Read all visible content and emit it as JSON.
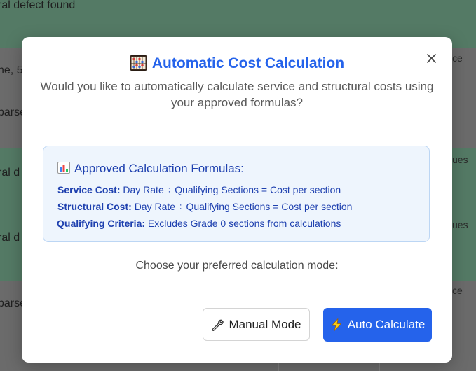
{
  "background": {
    "rows": [
      {
        "text": "ral defect found",
        "right": ""
      },
      {
        "text": "ne, 5",
        "right": "ce"
      },
      {
        "text": "parse",
        "right": ""
      },
      {
        "text": "ral d",
        "right": "ues"
      },
      {
        "text": "ral d",
        "right": "ues"
      },
      {
        "text": "parse",
        "right": "ce"
      }
    ]
  },
  "modal": {
    "title": "Automatic Cost Calculation",
    "title_icon": "abacus-icon",
    "subtitle": "Would you like to automatically calculate service and structural costs using your approved formulas?",
    "close_icon": "close-icon",
    "formulas": {
      "heading": "Approved Calculation Formulas:",
      "heading_icon": "bar-chart-icon",
      "items": [
        {
          "label": "Service Cost:",
          "value": "Day Rate ÷ Qualifying Sections = Cost per section"
        },
        {
          "label": "Structural Cost:",
          "value": "Day Rate ÷ Qualifying Sections = Cost per section"
        },
        {
          "label": "Qualifying Criteria:",
          "value": "Excludes Grade 0 sections from calculations"
        }
      ]
    },
    "prompt": "Choose your preferred calculation mode:",
    "manual_button": {
      "label": "Manual Mode",
      "icon": "wrench-icon"
    },
    "auto_button": {
      "label": "Auto Calculate",
      "icon": "lightning-icon"
    }
  },
  "colors": {
    "accent": "#2563eb",
    "formula_text": "#1e40af",
    "formula_bg": "#eef5fd"
  }
}
